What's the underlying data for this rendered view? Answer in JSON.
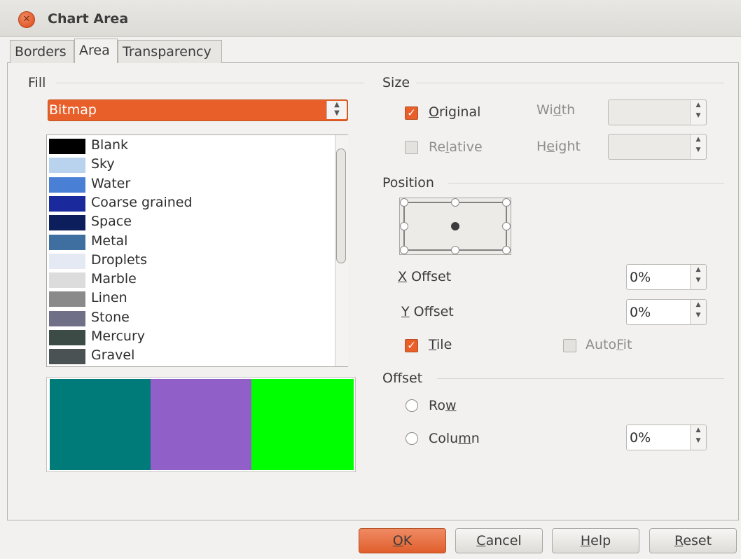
{
  "window": {
    "title": "Chart Area"
  },
  "tabs": [
    {
      "label": "Borders"
    },
    {
      "label": "Area"
    },
    {
      "label": "Transparency"
    }
  ],
  "fill": {
    "section_title": "Fill",
    "selected": "Bitmap",
    "bitmaps": [
      {
        "label": "Blank",
        "color": "#000000"
      },
      {
        "label": "Sky",
        "color": "#b9d3ee"
      },
      {
        "label": "Water",
        "color": "#4a7fd6"
      },
      {
        "label": "Coarse grained",
        "color": "#1a2a9c"
      },
      {
        "label": "Space",
        "color": "#0c1f5c"
      },
      {
        "label": "Metal",
        "color": "#3f6ea0"
      },
      {
        "label": "Droplets",
        "color": "#e4e9f3"
      },
      {
        "label": "Marble",
        "color": "#dcdcdc"
      },
      {
        "label": "Linen",
        "color": "#8a8a8a"
      },
      {
        "label": "Stone",
        "color": "#6f7088"
      },
      {
        "label": "Mercury",
        "color": "#3d4b46"
      },
      {
        "label": "Gravel",
        "color": "#4a5253"
      }
    ],
    "preview_colors": [
      "#007b7a",
      "#915fc8",
      "#00ff00"
    ]
  },
  "size": {
    "section_title": "Size",
    "original": {
      "label_pre": "",
      "label_key": "O",
      "label_post": "riginal",
      "checked": true
    },
    "relative": {
      "label_pre": "Re",
      "label_key": "l",
      "label_post": "ative",
      "checked": false
    },
    "width": {
      "label_pre": "Wi",
      "label_key": "d",
      "label_post": "th",
      "value": ""
    },
    "height": {
      "label_pre": "H",
      "label_key": "e",
      "label_post": "ight",
      "value": ""
    }
  },
  "position": {
    "section_title": "Position",
    "x_offset": {
      "label_key": "X",
      "label_post": " Offset",
      "value": "0%"
    },
    "y_offset": {
      "label_key": "Y",
      "label_post": " Offset",
      "value": "0%"
    },
    "tile": {
      "label_key": "T",
      "label_post": "ile",
      "checked": true
    },
    "autofit": {
      "label_pre": "Auto",
      "label_key": "F",
      "label_post": "it",
      "checked": false
    }
  },
  "offset": {
    "section_title": "Offset",
    "row": {
      "label_pre": "Ro",
      "label_key": "w",
      "label_post": ""
    },
    "column": {
      "label_pre": "Colu",
      "label_key": "m",
      "label_post": "n",
      "value": "0%"
    }
  },
  "buttons": {
    "ok": {
      "label_key": "O",
      "label_post": "K"
    },
    "cancel": {
      "label_key": "C",
      "label_post": "ancel"
    },
    "help": {
      "label_key": "H",
      "label_post": "elp"
    },
    "reset": {
      "label_key": "R",
      "label_post": "eset"
    }
  },
  "colors": {
    "accent": "#e95f2a"
  }
}
